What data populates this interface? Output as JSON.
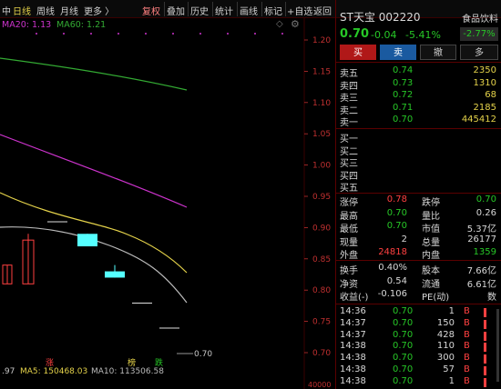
{
  "toolbar": {
    "period_fragment": "中",
    "daily": "日线",
    "weekly": "周线",
    "monthly": "月线",
    "more": "更多 〉",
    "fuquan": "复权",
    "overlay": "叠加",
    "history": "历史",
    "stats": "统计",
    "draw": "画线",
    "mark": "标记",
    "add_watch": "+自选",
    "back": "返回"
  },
  "ma": {
    "ma20": "MA20: 1.13",
    "ma60": "MA60: 1.21"
  },
  "price_axis": [
    "1.20",
    "1.15",
    "1.10",
    "1.05",
    "1.00",
    "0.95",
    "0.90",
    "0.85",
    "0.80",
    "0.75",
    "0.70"
  ],
  "vol_axis_label": "40000",
  "chart_marks": {
    "zhang": "涨",
    "bang": "榜",
    "die": "跌",
    "price_label": "0.70"
  },
  "bottom": {
    "vol_fragment": ".97",
    "ma5": "MA5: 150468.03",
    "ma10": "MA10: 113506.58"
  },
  "colors": {
    "up": "#ff4040",
    "down": "#27c727",
    "ma20": "#cc33cc",
    "ma60": "#33aa33",
    "ma5": "#e4d24a",
    "ma10": "#bbbbbb",
    "panel_border": "#5a0000"
  },
  "chart_data": {
    "type": "candlestick",
    "candles": [
      {
        "open": 0.84,
        "close": 0.81,
        "high": 0.84,
        "low": 0.81,
        "color": "red"
      },
      {
        "open": 0.81,
        "close": 0.88,
        "high": 0.89,
        "low": 0.81,
        "color": "red"
      },
      {
        "open": 0.91,
        "close": 0.91,
        "high": 0.91,
        "low": 0.91,
        "color": "white"
      },
      {
        "open": 0.89,
        "close": 0.87,
        "high": 0.89,
        "low": 0.87,
        "color": "cyan"
      },
      {
        "open": 0.83,
        "close": 0.82,
        "high": 0.84,
        "low": 0.82,
        "color": "cyan"
      },
      {
        "open": 0.78,
        "close": 0.78,
        "high": 0.78,
        "low": 0.78,
        "color": "white"
      },
      {
        "open": 0.74,
        "close": 0.74,
        "high": 0.74,
        "low": 0.74,
        "color": "white"
      }
    ]
  },
  "quote": {
    "name_code": "ST天宝 002220",
    "sector": "食品饮料",
    "price": "0.70",
    "change": "-0.04",
    "pct": "-5.41%",
    "sector_pct": "-2.77%",
    "buy": "买",
    "sell": "卖",
    "cancel": "撤",
    "more": "多"
  },
  "asks": [
    {
      "label": "卖五",
      "price": "0.74",
      "vol": "2350"
    },
    {
      "label": "卖四",
      "price": "0.73",
      "vol": "1310"
    },
    {
      "label": "卖三",
      "price": "0.72",
      "vol": "68"
    },
    {
      "label": "卖二",
      "price": "0.71",
      "vol": "2185"
    },
    {
      "label": "卖一",
      "price": "0.70",
      "vol": "445412"
    }
  ],
  "bids": [
    {
      "label": "买一"
    },
    {
      "label": "买二"
    },
    {
      "label": "买三"
    },
    {
      "label": "买四"
    },
    {
      "label": "买五"
    }
  ],
  "stats": [
    [
      "涨停",
      "0.78",
      "跌停",
      "0.70"
    ],
    [
      "最高",
      "0.70",
      "量比",
      "0.26"
    ],
    [
      "最低",
      "0.70",
      "市值",
      "5.37亿"
    ],
    [
      "现量",
      "2",
      "总量",
      "26177"
    ],
    [
      "外盘",
      "24818",
      "内盘",
      "1359"
    ]
  ],
  "stats2": [
    [
      "换手",
      "0.40%",
      "股本",
      "7.66亿"
    ],
    [
      "净资",
      "0.54",
      "流通",
      "6.61亿"
    ],
    [
      "收益(-)",
      "-0.106",
      "PE(动)",
      "数"
    ]
  ],
  "ticks": [
    {
      "time": "14:36",
      "price": "0.70",
      "vol": "1",
      "side": "B"
    },
    {
      "time": "14:37",
      "price": "0.70",
      "vol": "150",
      "side": "B"
    },
    {
      "time": "14:37",
      "price": "0.70",
      "vol": "428",
      "side": "B"
    },
    {
      "time": "14:38",
      "price": "0.70",
      "vol": "110",
      "side": "B"
    },
    {
      "time": "14:38",
      "price": "0.70",
      "vol": "300",
      "side": "B"
    },
    {
      "time": "14:38",
      "price": "0.70",
      "vol": "57",
      "side": "B"
    },
    {
      "time": "14:38",
      "price": "0.70",
      "vol": "1",
      "side": "B"
    }
  ]
}
